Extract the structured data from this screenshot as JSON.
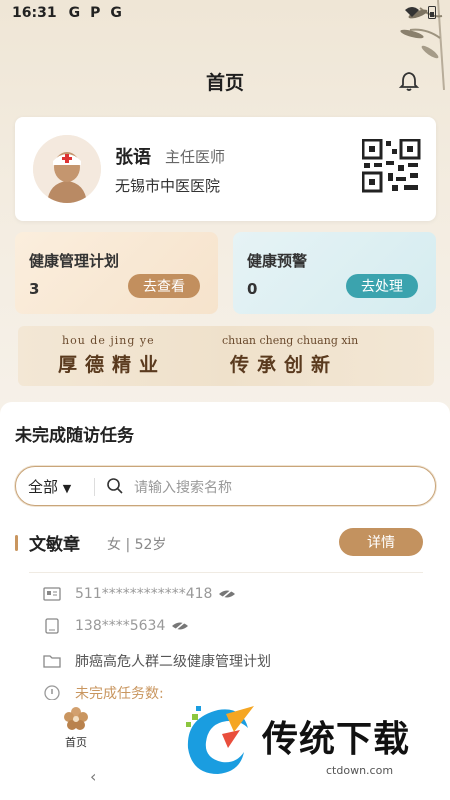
{
  "status_bar": {
    "time": "16:31",
    "notif_icons": [
      "G",
      "P",
      "G"
    ]
  },
  "header": {
    "title": "首页"
  },
  "doctor": {
    "name": "张语",
    "title": "主任医师",
    "hospital": "无锡市中医医院"
  },
  "plan_card": {
    "title": "健康管理计划",
    "count": "3",
    "button": "去查看"
  },
  "warning_card": {
    "title": "健康预警",
    "count": "0",
    "button": "去处理"
  },
  "banner": {
    "left_pinyin": "hou  de  jing  ye",
    "left_text": "厚德精业",
    "right_pinyin": "chuan cheng chuang xin",
    "right_text": "传承创新"
  },
  "tasks": {
    "title": "未完成随访任务",
    "filter": {
      "selected": "全部"
    },
    "search": {
      "placeholder": "请输入搜索名称"
    }
  },
  "patient": {
    "name": "文敏章",
    "info": "女 | 52岁",
    "detail_button": "详情",
    "id_number": "511************418",
    "phone": "138****5634",
    "plan": "肺癌高危人群二级健康管理计划",
    "pending": "未完成任务数:"
  },
  "bottom_nav": {
    "home_label": "首页"
  },
  "watermark": {
    "text": "传统下载",
    "url": "ctdown.com"
  },
  "colors": {
    "accent_brown": "#c3925f",
    "accent_teal": "#3ba3ae",
    "background": "#f7f3ec"
  },
  "icons": [
    "bell-icon",
    "qr-code-icon",
    "search-icon",
    "id-card-icon",
    "phone-icon",
    "eye-off-icon",
    "folder-icon",
    "info-icon",
    "home-flower-icon",
    "chevron-left-icon"
  ]
}
